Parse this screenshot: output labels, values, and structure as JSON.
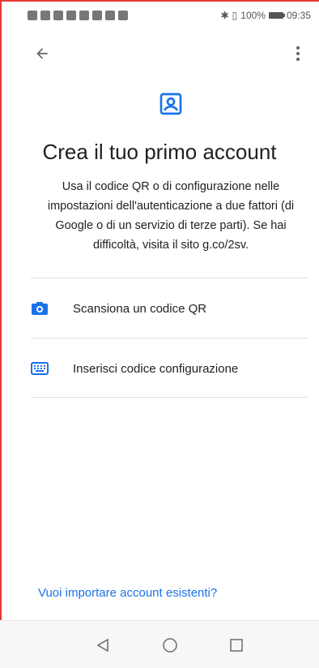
{
  "status_bar": {
    "battery_text": "100%",
    "time": "09:35"
  },
  "header": {
    "back_icon": "arrow-back-icon",
    "menu_icon": "more-vert-icon"
  },
  "hero": {
    "icon": "account-box-icon",
    "title": "Crea il tuo primo account",
    "description": "Usa il codice QR o di configurazione nelle impostazioni dell'autenticazione a due fattori (di Google o di un servizio di terze parti). Se hai difficoltà, visita il sito g.co/2sv."
  },
  "options": [
    {
      "icon": "camera-icon",
      "label": "Scansiona un codice QR"
    },
    {
      "icon": "keyboard-icon",
      "label": "Inserisci codice configurazione"
    }
  ],
  "footer": {
    "import_link": "Vuoi importare account esistenti?"
  },
  "colors": {
    "accent": "#1a73e8",
    "divider": "#e0e0e0",
    "text": "#202124"
  }
}
